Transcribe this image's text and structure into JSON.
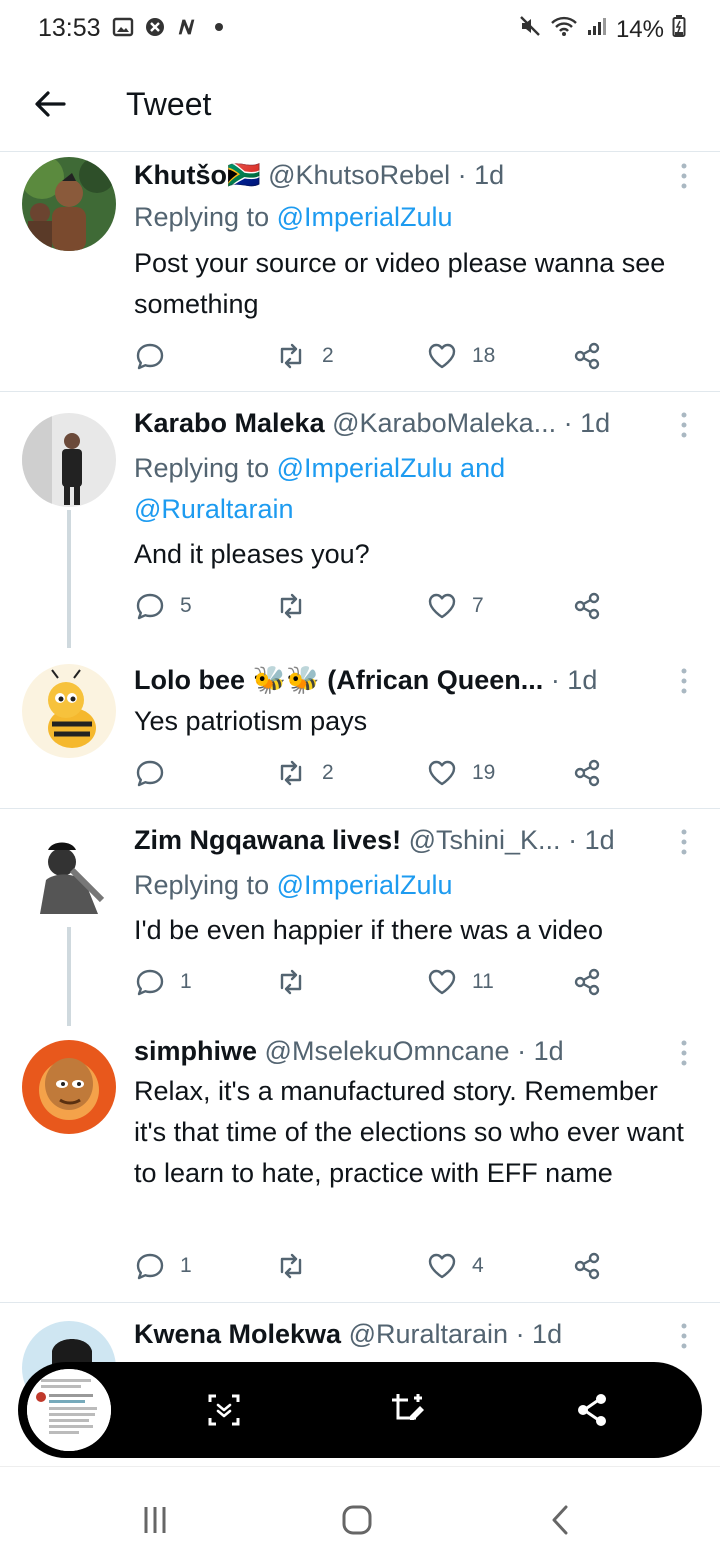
{
  "status_bar": {
    "time": "13:53",
    "battery": "14%"
  },
  "header": {
    "title": "Tweet"
  },
  "tweets": [
    {
      "name": "Khutšo🇿🇦",
      "handle": "@KhutsoRebel",
      "time": "· 1d",
      "reply_prefix": "Replying to ",
      "reply_mentions": "@ImperialZulu",
      "text": "Post your source or video please wanna see something",
      "replies": "",
      "retweets": "2",
      "likes": "18"
    },
    {
      "name": "Karabo Maleka",
      "handle": "@KaraboMaleka...",
      "time": "· 1d",
      "reply_prefix": "Replying to ",
      "reply_mentions": "@ImperialZulu and @Ruraltarain",
      "text": "And it pleases you?",
      "replies": "5",
      "retweets": "",
      "likes": "7"
    },
    {
      "name": "Lolo bee 🐝🐝 (African Queen...",
      "handle": "",
      "time": "· 1d",
      "reply_prefix": "",
      "reply_mentions": "",
      "text": "Yes patriotism pays",
      "replies": "",
      "retweets": "2",
      "likes": "19"
    },
    {
      "name": "Zim Ngqawana lives!",
      "handle": "@Tshini_K...",
      "time": "· 1d",
      "reply_prefix": "Replying to ",
      "reply_mentions": "@ImperialZulu",
      "text": "I'd be even happier if there was a video",
      "replies": "1",
      "retweets": "",
      "likes": "11"
    },
    {
      "name": "simphiwe",
      "handle": "@MselekuOmncane",
      "time": "· 1d",
      "reply_prefix": "",
      "reply_mentions": "",
      "text": "Relax, it's a manufactured story. Remember it's that time of the elections so who ever want to learn to hate, practice with EFF name",
      "replies": "1",
      "retweets": "",
      "likes": "4"
    },
    {
      "name": "Kwena Molekwa",
      "handle": "@Ruraltarain",
      "time": "· 1d",
      "reply_prefix": "",
      "reply_mentions": "",
      "text": "",
      "replies": "",
      "retweets": "",
      "likes": ""
    }
  ],
  "colors": {
    "accent": "#1d9bf0",
    "text": "#0f1419",
    "muted": "#536471"
  }
}
